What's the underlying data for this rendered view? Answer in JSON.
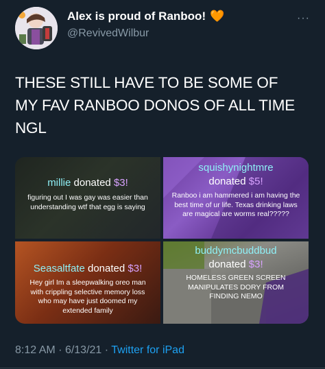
{
  "tweet": {
    "display_name": "Alex is proud of Ranboo!",
    "name_emoji": "🧡",
    "handle": "@RevivedWilbur",
    "text": "THESE STILL HAVE TO BE SOME OF MY FAV RANBOO DONOS OF ALL TIME NGL",
    "time": "8:12 AM",
    "date": "6/13/21",
    "separator": "·",
    "source": "Twitter for iPad",
    "more_label": "···"
  },
  "donations": [
    {
      "donor": "millie",
      "donated_word": "donated",
      "amount": "$3!",
      "message": "figuring out I was gay was easier than understanding wtf that egg is saying"
    },
    {
      "donor": "squishynightmre",
      "donated_word": "donated",
      "amount": "$5!",
      "message": "Ranboo i am hammered i am having the best time of ur life. Texas drinking laws are magical are worms real?????"
    },
    {
      "donor": "Seasaltfate",
      "donated_word": "donated",
      "amount": "$3!",
      "message": "Hey girl Im a sleepwalking oreo man with crippling selective memory loss who may have just doomed my extended family"
    },
    {
      "donor": "buddymcbuddbud",
      "donated_word": "donated",
      "amount": "$3!",
      "message": "HOMELESS GREEN SCREEN MANIPULATES DORY FROM FINDING NEMO"
    }
  ],
  "colors": {
    "background": "#15202b",
    "muted_text": "#8899a6",
    "link": "#1da1f2",
    "donor_highlight": "#8ff0f6",
    "amount_highlight": "#d8a2ff"
  }
}
